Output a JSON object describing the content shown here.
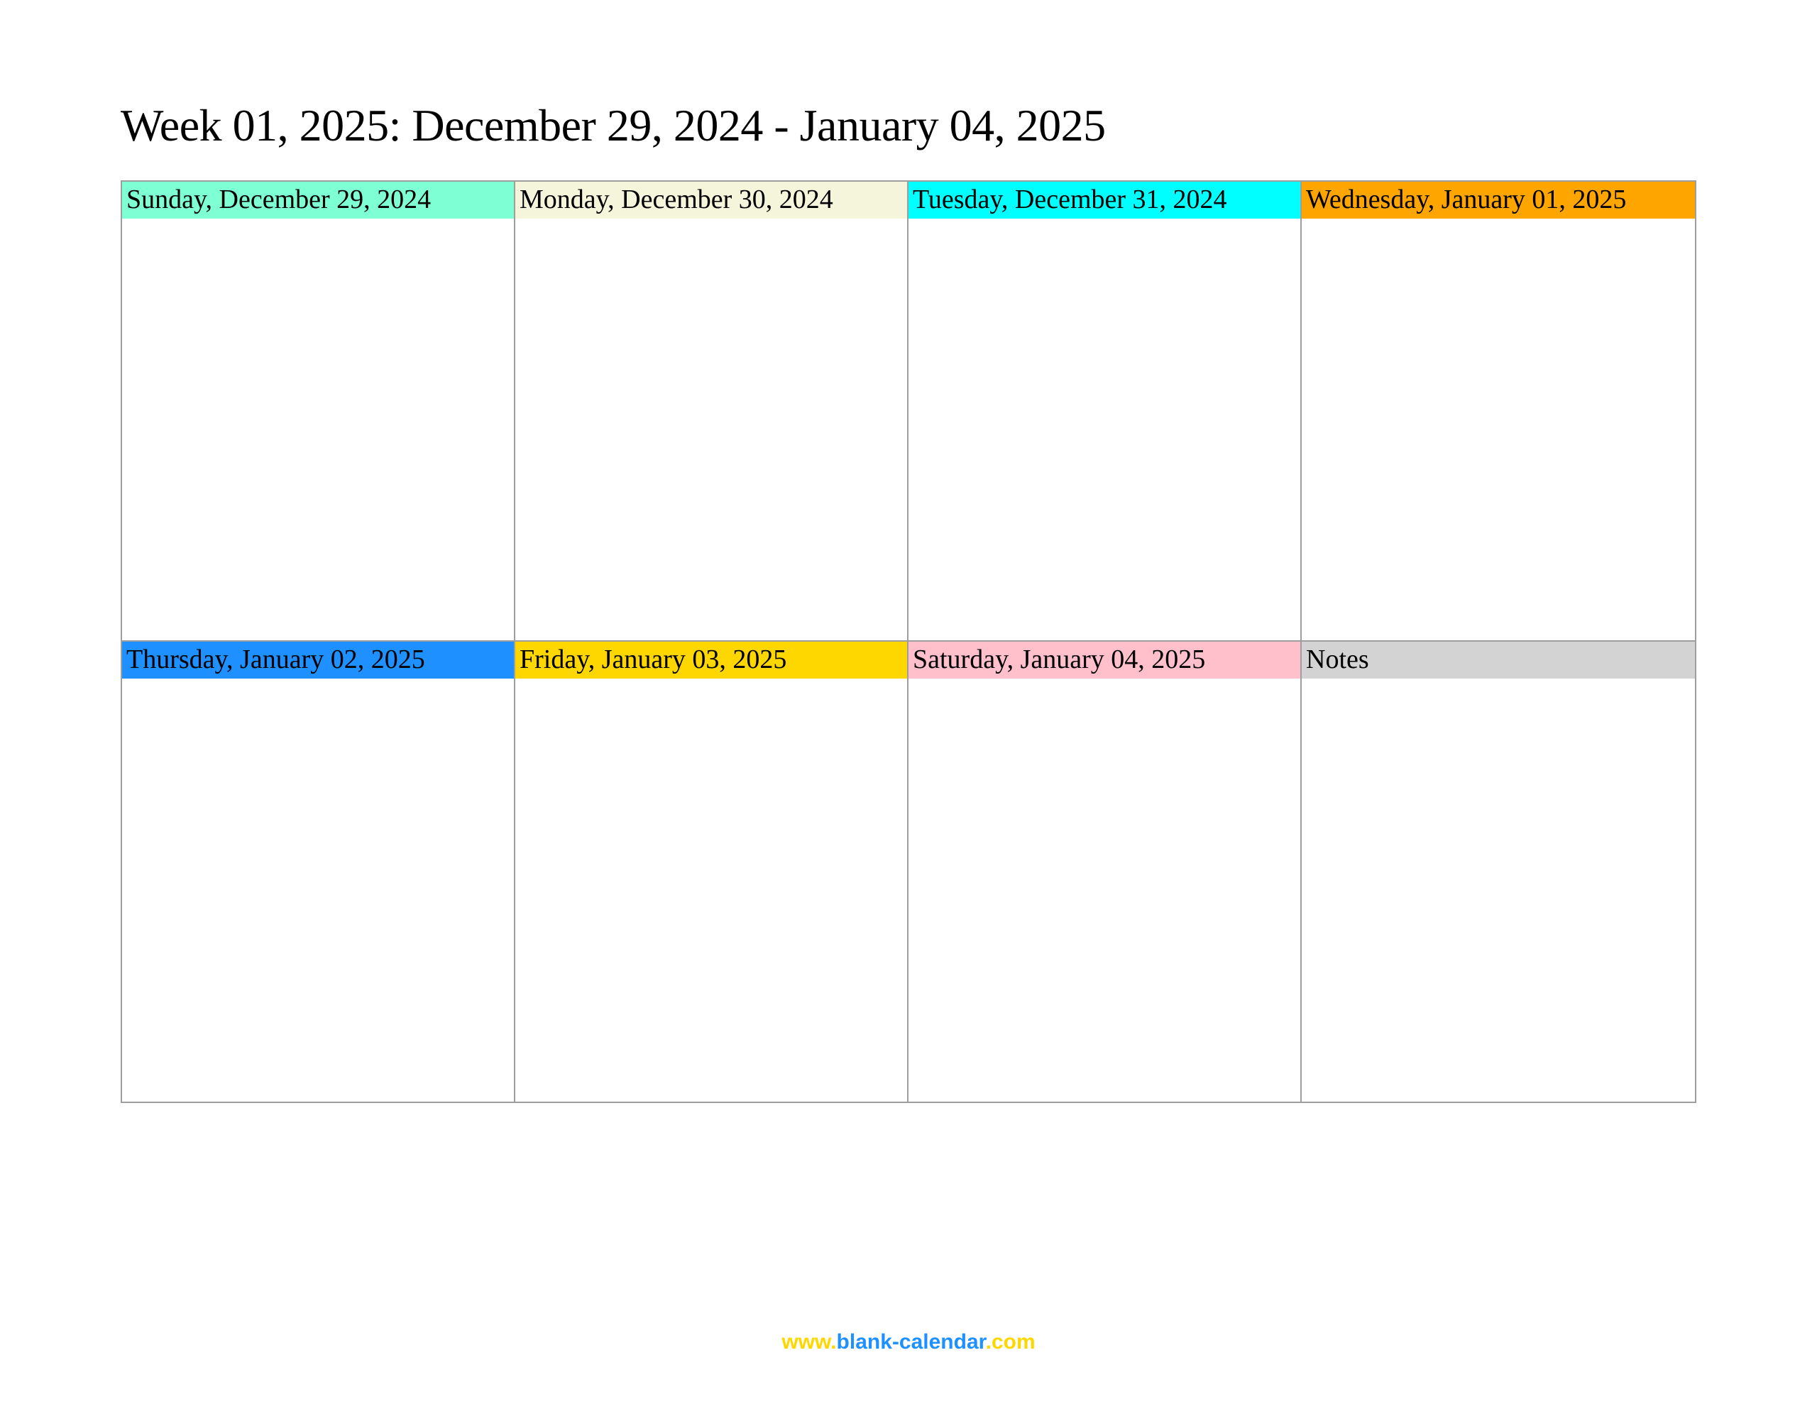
{
  "title": "Week 01, 2025: December 29, 2024 - January 04, 2025",
  "cells": {
    "sunday": "Sunday, December 29, 2024",
    "monday": "Monday, December 30, 2024",
    "tuesday": "Tuesday, December 31, 2024",
    "wednesday": "Wednesday, January 01, 2025",
    "thursday": "Thursday, January 02, 2025",
    "friday": "Friday, January 03, 2025",
    "saturday": "Saturday, January 04, 2025",
    "notes": "Notes"
  },
  "footer": {
    "prefix": "www.",
    "main": "blank-calendar",
    "suffix": ".com"
  }
}
